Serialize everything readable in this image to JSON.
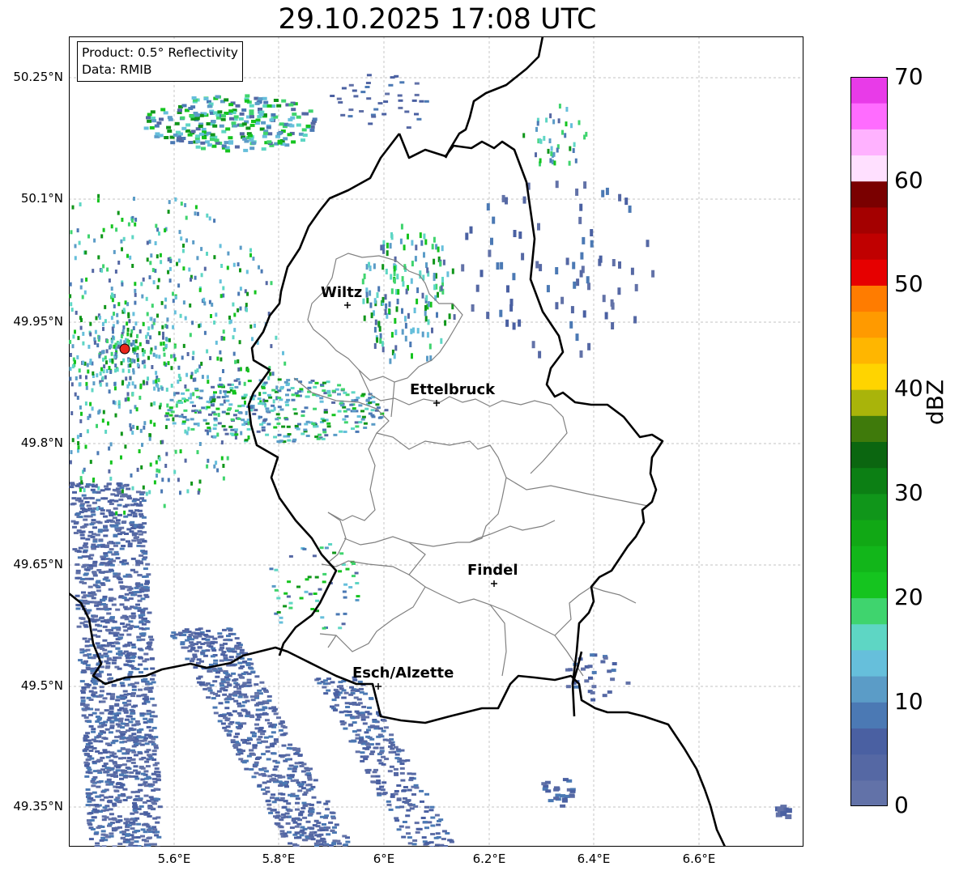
{
  "title": "29.10.2025 17:08 UTC",
  "info": {
    "product": "Product: 0.5° Reflectivity",
    "data": "Data: RMIB"
  },
  "axes": {
    "y_ticks": [
      "50.25°N",
      "50.1°N",
      "49.95°N",
      "49.8°N",
      "49.65°N",
      "49.5°N",
      "49.35°N"
    ],
    "x_ticks": [
      "5.6°E",
      "5.8°E",
      "6°E",
      "6.2°E",
      "6.4°E",
      "6.6°E"
    ]
  },
  "cities": [
    {
      "name": "Wiltz"
    },
    {
      "name": "Ettelbruck"
    },
    {
      "name": "Findel"
    },
    {
      "name": "Esch/Alzette"
    }
  ],
  "radar_site": {
    "color": "#e8261a"
  },
  "colorbar": {
    "label": "dBZ",
    "ticks": [
      "0",
      "10",
      "20",
      "30",
      "40",
      "50",
      "60",
      "70"
    ],
    "min": 0,
    "max": 70,
    "step": 2.5,
    "colors": [
      "#6272a8",
      "#5568a4",
      "#4a60a2",
      "#4b79b4",
      "#5b9cc7",
      "#66bfdb",
      "#5ed6c4",
      "#3fd46e",
      "#15c41f",
      "#12b61a",
      "#11a815",
      "#10961a",
      "#0c7f14",
      "#0b6610",
      "#3f7a0b",
      "#a9b40a",
      "#ffd400",
      "#ffb600",
      "#ff9a00",
      "#ff7c00",
      "#e60000",
      "#c00000",
      "#a40000",
      "#7a0000",
      "#ffe0ff",
      "#ffb2ff",
      "#ff6cff",
      "#e83be8"
    ]
  }
}
